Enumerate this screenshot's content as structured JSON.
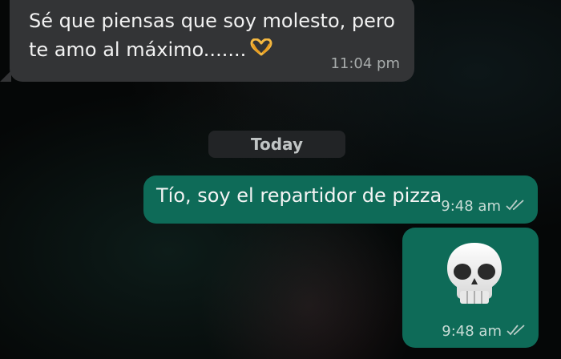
{
  "messages": {
    "incoming_1": {
      "text": "Sé que piensas que soy molesto, pero te amo al máximo.......",
      "emoji_icon": "heart-hands-icon",
      "time": "11:04 pm"
    },
    "date_separator": "Today",
    "outgoing_1": {
      "text": "Tío, soy el repartidor de pizza",
      "time": "9:48 am",
      "status_icon": "double-check-icon"
    },
    "outgoing_2": {
      "emoji_icon": "skull-icon",
      "time": "9:48 am",
      "status_icon": "double-check-icon"
    }
  },
  "colors": {
    "incoming_bubble": "#333436",
    "outgoing_bubble": "#0e6b58",
    "date_chip": "#222426",
    "background": "#050707"
  }
}
